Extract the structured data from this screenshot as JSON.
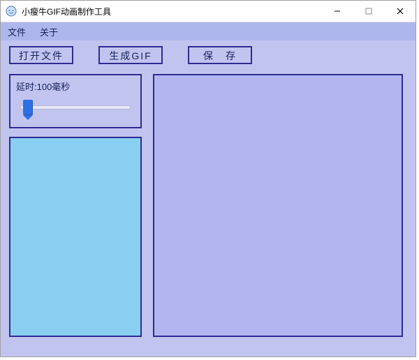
{
  "window": {
    "title": "小瘦牛GIF动画制作工具"
  },
  "menubar": {
    "file": "文件",
    "about": "关于"
  },
  "toolbar": {
    "open_label": "打开文件",
    "generate_label": "生成GIF",
    "save_label": "保　存"
  },
  "delay": {
    "label_prefix": "延时:",
    "value": 100,
    "unit": "毫秒",
    "full_label": "延时:100毫秒"
  }
}
